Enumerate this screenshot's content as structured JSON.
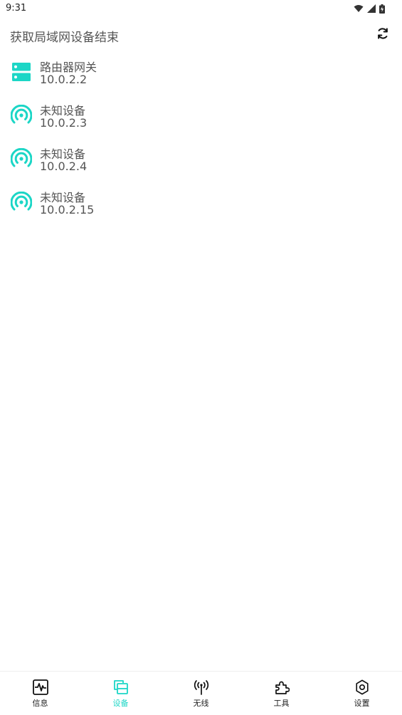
{
  "status_bar": {
    "time": "9:31"
  },
  "header": {
    "title": "获取局域网设备结束"
  },
  "devices": [
    {
      "name": "路由器网关",
      "ip": "10.0.2.2",
      "icon": "server-icon"
    },
    {
      "name": "未知设备",
      "ip": "10.0.2.3",
      "icon": "broadcast-icon"
    },
    {
      "name": "未知设备",
      "ip": "10.0.2.4",
      "icon": "broadcast-icon"
    },
    {
      "name": "未知设备",
      "ip": "10.0.2.15",
      "icon": "broadcast-icon"
    }
  ],
  "nav": {
    "items": [
      {
        "label": "信息",
        "icon": "activity-icon"
      },
      {
        "label": "设备",
        "icon": "devices-icon",
        "active": true
      },
      {
        "label": "无线",
        "icon": "antenna-icon"
      },
      {
        "label": "工具",
        "icon": "puzzle-icon"
      },
      {
        "label": "设置",
        "icon": "gear-icon"
      }
    ]
  },
  "colors": {
    "accent": "#1cd6c6",
    "text": "#555555"
  }
}
